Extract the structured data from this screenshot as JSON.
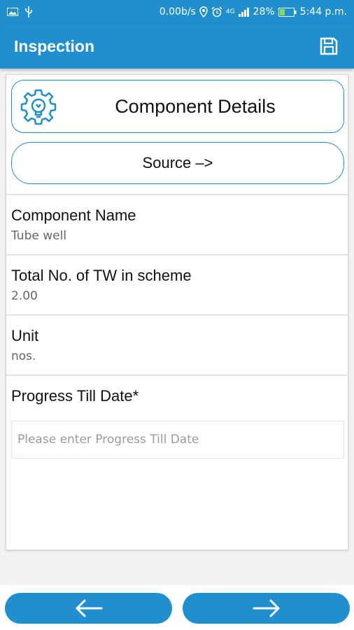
{
  "status_bar": {
    "network_speed": "0.00b/s",
    "signal_label": "4G",
    "battery": "28%",
    "time": "5:44 p.m.",
    "icons": [
      "image-icon",
      "usb-icon",
      "location-icon",
      "alarm-icon",
      "signal-icon",
      "battery-icon"
    ]
  },
  "app_bar": {
    "title": "Inspection",
    "save_icon": "save-icon"
  },
  "header": {
    "icon": "gear-lightbulb-icon",
    "label": "Component Details"
  },
  "source_button": {
    "label": "Source –>"
  },
  "fields": [
    {
      "label": "Component Name",
      "value": "Tube well"
    },
    {
      "label": "Total No. of TW in scheme",
      "value": "2.00"
    },
    {
      "label": "Unit",
      "value": "nos."
    }
  ],
  "progress": {
    "label": "Progress Till Date*",
    "placeholder": "Please enter Progress Till Date"
  },
  "nav": {
    "prev_icon": "arrow-left-icon",
    "next_icon": "arrow-right-icon"
  },
  "colors": {
    "primary": "#1f8fcf",
    "background": "#f2f2f2",
    "text": "#111111",
    "muted": "#666666"
  }
}
